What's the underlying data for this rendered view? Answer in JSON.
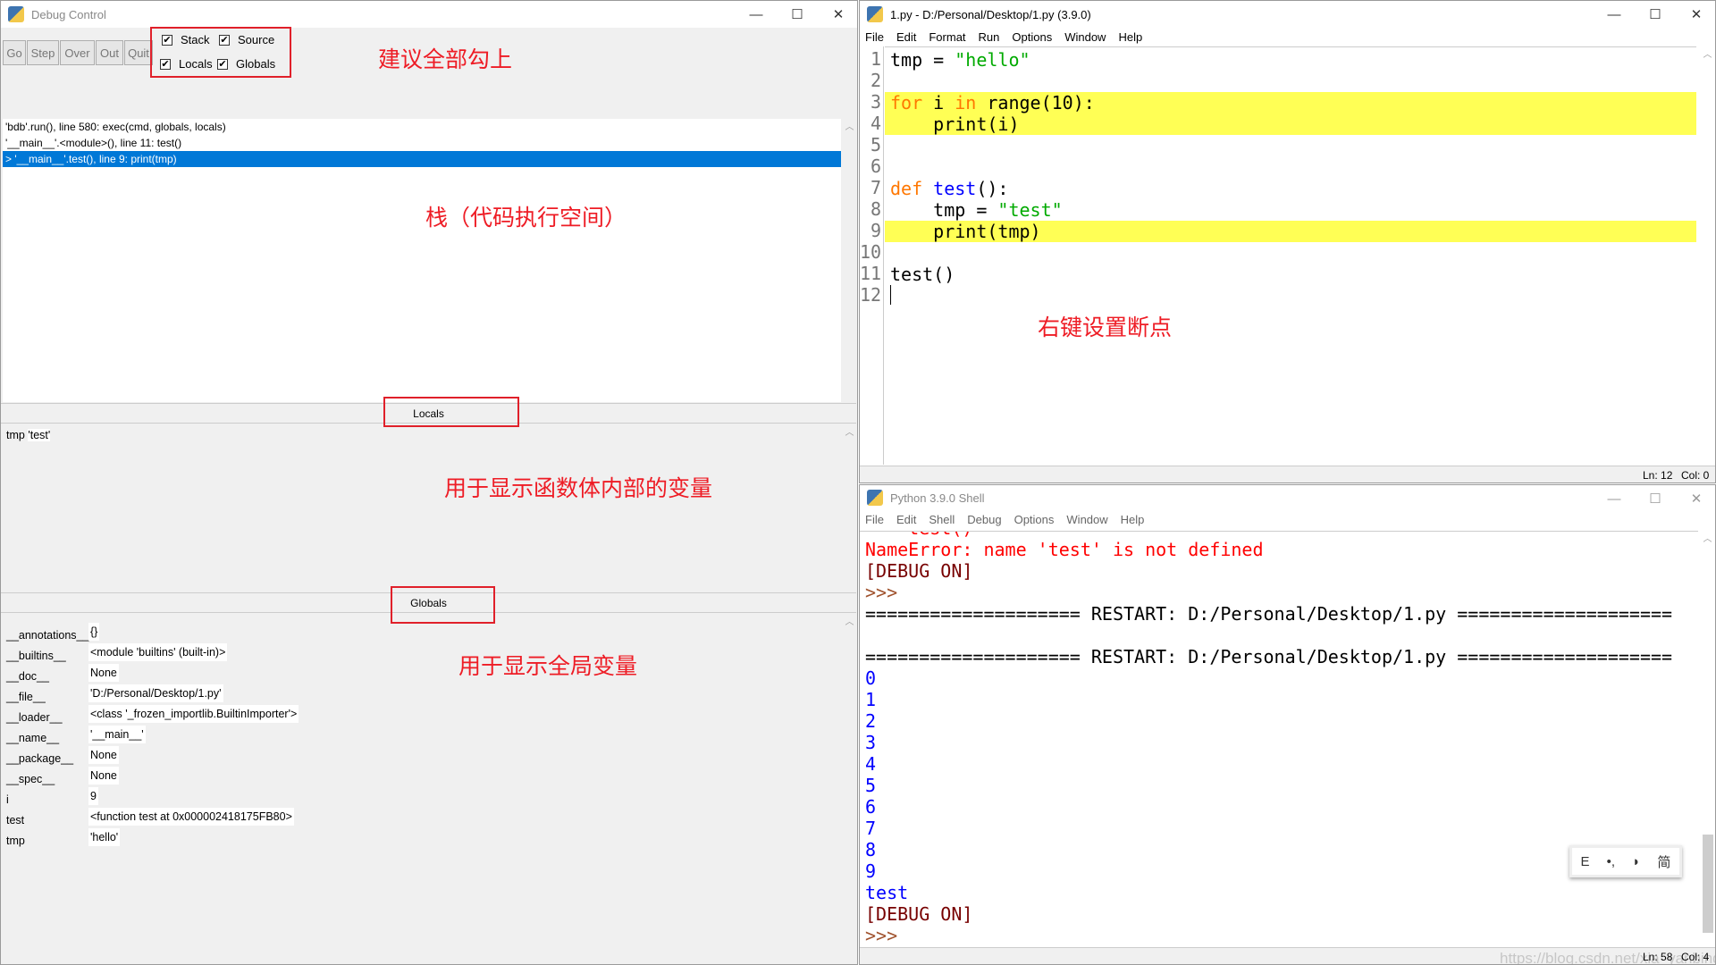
{
  "debug": {
    "title": "Debug Control",
    "buttons": [
      "Go",
      "Step",
      "Over",
      "Out",
      "Quit"
    ],
    "checkboxes": [
      {
        "label": "Stack",
        "checked": true
      },
      {
        "label": "Source",
        "checked": true
      },
      {
        "label": "Locals",
        "checked": true
      },
      {
        "label": "Globals",
        "checked": true
      }
    ],
    "stack": [
      "'bdb'.run(), line 580: exec(cmd, globals, locals)",
      "'__main__'.<module>(), line 11: test()",
      "> '__main__'.test(), line 9: print(tmp)"
    ],
    "selected_stack_index": 2,
    "locals_header": "Locals",
    "locals": [
      {
        "name": "tmp",
        "value": "'test'"
      }
    ],
    "globals_header": "Globals",
    "globals": [
      {
        "name": "__annotations__",
        "value": "{}"
      },
      {
        "name": "__builtins__",
        "value": "<module 'builtins' (built-in)>"
      },
      {
        "name": "__doc__",
        "value": "None"
      },
      {
        "name": "__file__",
        "value": "'D:/Personal/Desktop/1.py'"
      },
      {
        "name": "__loader__",
        "value": "<class '_frozen_importlib.BuiltinImporter'>"
      },
      {
        "name": "__name__",
        "value": "'__main__'"
      },
      {
        "name": "__package__",
        "value": "None"
      },
      {
        "name": "__spec__",
        "value": "None"
      },
      {
        "name": "i",
        "value": "9"
      },
      {
        "name": "test",
        "value": "<function test at 0x000002418175FB80>"
      },
      {
        "name": "tmp",
        "value": "'hello'"
      }
    ]
  },
  "annotations": {
    "check_all": "建议全部勾上",
    "stack": "栈（代码执行空间）",
    "locals": "用于显示函数体内部的变量",
    "globals": "用于显示全局变量",
    "breakpoint": "右键设置断点"
  },
  "editor": {
    "title": "1.py - D:/Personal/Desktop/1.py (3.9.0)",
    "menu": [
      "File",
      "Edit",
      "Format",
      "Run",
      "Options",
      "Window",
      "Help"
    ],
    "breakpoint_color": "#ffff55",
    "lines": [
      {
        "n": "1",
        "tokens": [
          {
            "t": "tmp = ",
            "c": ""
          },
          {
            "t": "\"hello\"",
            "c": "str"
          }
        ]
      },
      {
        "n": "2",
        "tokens": []
      },
      {
        "n": "3",
        "bp": true,
        "tokens": [
          {
            "t": "for",
            "c": "kw"
          },
          {
            "t": " i ",
            "c": ""
          },
          {
            "t": "in",
            "c": "kw"
          },
          {
            "t": " range(10):",
            "c": ""
          }
        ]
      },
      {
        "n": "4",
        "bp": true,
        "tokens": [
          {
            "t": "    print(i)",
            "c": ""
          }
        ]
      },
      {
        "n": "5",
        "tokens": []
      },
      {
        "n": "6",
        "tokens": []
      },
      {
        "n": "7",
        "tokens": [
          {
            "t": "def",
            "c": "kw"
          },
          {
            "t": " ",
            "c": ""
          },
          {
            "t": "test",
            "c": "def"
          },
          {
            "t": "():",
            "c": ""
          }
        ]
      },
      {
        "n": "8",
        "tokens": [
          {
            "t": "    tmp = ",
            "c": ""
          },
          {
            "t": "\"test\"",
            "c": "str"
          }
        ]
      },
      {
        "n": "9",
        "bp": true,
        "tokens": [
          {
            "t": "    print(tmp)",
            "c": ""
          }
        ]
      },
      {
        "n": "10",
        "tokens": []
      },
      {
        "n": "11",
        "tokens": [
          {
            "t": "test()",
            "c": ""
          }
        ]
      },
      {
        "n": "12",
        "tokens": []
      }
    ],
    "status": {
      "ln": "Ln: 12",
      "col": "Col: 0"
    }
  },
  "shell": {
    "title": "Python 3.9.0 Shell",
    "menu": [
      "File",
      "Edit",
      "Shell",
      "Debug",
      "Options",
      "Window",
      "Help"
    ],
    "lines": [
      {
        "t": "    test()",
        "c": "err"
      },
      {
        "t": "NameError: name 'test' is not defined",
        "c": "err"
      },
      {
        "t": "[DEBUG ON]",
        "c": "dbg"
      },
      {
        "t": ">>> ",
        "c": "prm"
      },
      {
        "t": "==================== RESTART: D:/Personal/Desktop/1.py ====================",
        "c": ""
      },
      {
        "t": "",
        "c": ""
      },
      {
        "t": "==================== RESTART: D:/Personal/Desktop/1.py ====================",
        "c": ""
      },
      {
        "t": "0",
        "c": "out"
      },
      {
        "t": "1",
        "c": "out"
      },
      {
        "t": "2",
        "c": "out"
      },
      {
        "t": "3",
        "c": "out"
      },
      {
        "t": "4",
        "c": "out"
      },
      {
        "t": "5",
        "c": "out"
      },
      {
        "t": "6",
        "c": "out"
      },
      {
        "t": "7",
        "c": "out"
      },
      {
        "t": "8",
        "c": "out"
      },
      {
        "t": "9",
        "c": "out"
      },
      {
        "t": "test",
        "c": "out"
      },
      {
        "t": "[DEBUG ON]",
        "c": "dbg"
      },
      {
        "t": ">>> ",
        "c": "prm"
      }
    ],
    "status": {
      "ln": "Ln: 58",
      "col": "Col: 4"
    },
    "ime": [
      "E",
      "•,",
      "◗",
      "简"
    ],
    "watermark": "https://blog.csdn.net/xia_yanbing"
  }
}
